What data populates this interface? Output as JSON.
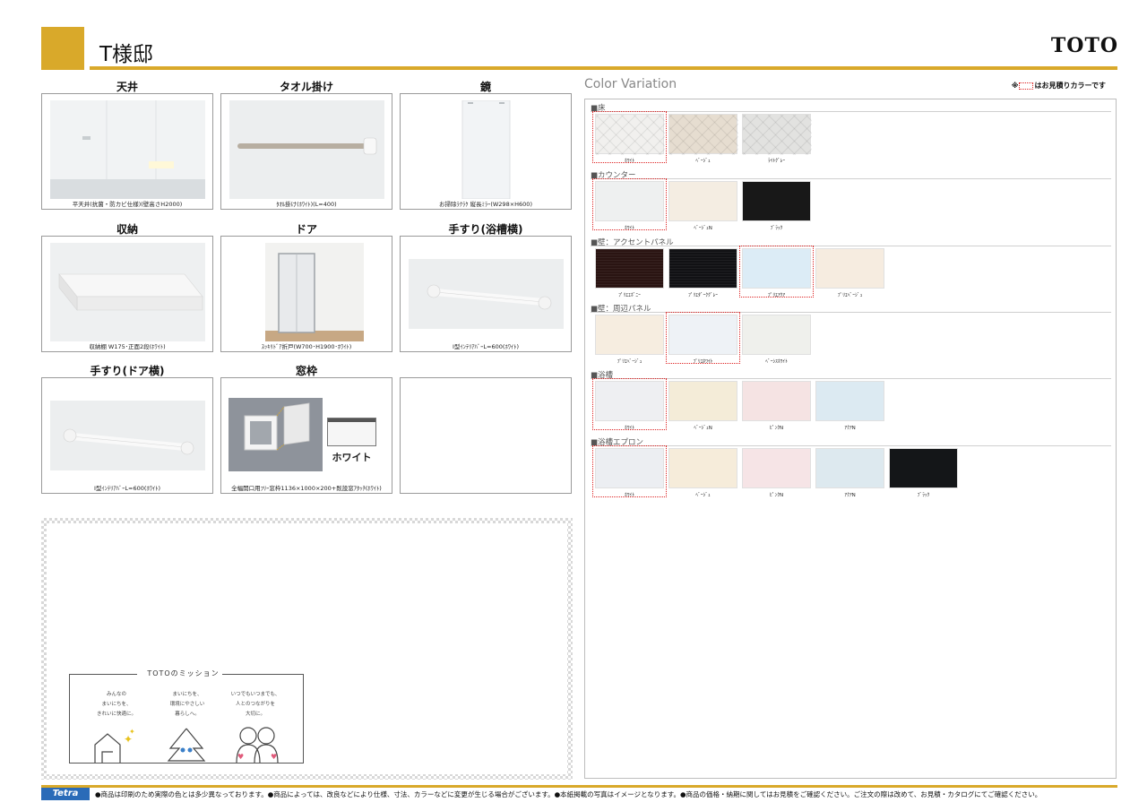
{
  "header": {
    "title": "T様邸",
    "brand": "TOTO"
  },
  "products": [
    {
      "title": "天井",
      "caption": "平天井(抗菌・防カビ仕様)(壁高さH2000)"
    },
    {
      "title": "タオル掛け",
      "caption": "ﾀｵﾙ掛け(ﾎﾜｲﾄ)(L=400)"
    },
    {
      "title": "鏡",
      "caption": "お掃除ﾗｸﾗｸ 縦長ﾐﾗｰ(W298×H600)"
    },
    {
      "title": "収納",
      "caption": "収納棚 W175･正面2段(ﾎﾜｲﾄ)"
    },
    {
      "title": "ドア",
      "caption": "ｽｯｷﾘﾄﾞｱ折戸(W700･H1900･ﾎﾜｲﾄ)"
    },
    {
      "title": "手すり(浴槽横)",
      "caption": "I型ｲﾝﾃﾘｱﾊﾞｰL=600(ﾎﾜｲﾄ)"
    },
    {
      "title": "手すり(ドア横)",
      "caption": "I型ｲﾝﾃﾘｱﾊﾞｰL=600(ﾎﾜｲﾄ)"
    },
    {
      "title": "窓枠",
      "caption": "全幅開口用ﾌﾘｰ窓枠1136×1000×200+既設窓ｱﾀｯﾁ(ﾎﾜｲﾄ)",
      "swatch_label": "ホワイト"
    },
    {
      "title": "",
      "caption": ""
    }
  ],
  "mission": {
    "title": "TOTOのミッション",
    "col1": [
      "みんなの",
      "まいにちを、",
      "きれいに快適に。"
    ],
    "col2": [
      "まいにちを、",
      "環境にやさしい",
      "暮らしへ。"
    ],
    "col3": [
      "いつでもいつまでも、",
      "人とのつながりを",
      "大切に。"
    ]
  },
  "color_variation": {
    "title": "Color Variation",
    "note_prefix": "※",
    "note_suffix": "はお見積りカラーです",
    "sections": [
      {
        "name": "■床",
        "swatches": [
          {
            "label": "ﾎﾜｲﾄ",
            "color": "#f1f0ee",
            "selected": true
          },
          {
            "label": "ﾍﾞｰｼﾞｭ",
            "color": "#e6ddd0"
          },
          {
            "label": "ﾗｲﾄｸﾞﾚｰ",
            "color": "#e2e2e0"
          }
        ]
      },
      {
        "name": "■カウンター",
        "swatches": [
          {
            "label": "ﾎﾜｲﾄ",
            "color": "#eef0f0",
            "selected": true
          },
          {
            "label": "ﾍﾞｰｼﾞｭN",
            "color": "#f4ede2"
          },
          {
            "label": "ﾌﾞﾗｯｸ",
            "color": "#181818"
          }
        ]
      },
      {
        "name": "■壁：アクセントパネル",
        "swatches": [
          {
            "label": "ﾌﾟﾘｴｴﾎﾞﾆｰ",
            "color": "#2a1412"
          },
          {
            "label": "ﾌﾟﾘｴﾀﾞｰｸｸﾞﾚｰ",
            "color": "#111114"
          },
          {
            "label": "ﾌﾟﾘｴｱｸｱ",
            "color": "#dcecf6",
            "selected": true
          },
          {
            "label": "ﾌﾟﾘｴﾍﾞｰｼﾞｭ",
            "color": "#f6ece0"
          }
        ]
      },
      {
        "name": "■壁：周辺パネル",
        "swatches": [
          {
            "label": "ﾌﾟﾘｴﾍﾞｰｼﾞｭ",
            "color": "#f6ede0"
          },
          {
            "label": "ﾌﾟﾘｴﾎﾜｲﾄ",
            "color": "#eef2f6",
            "selected": true
          },
          {
            "label": "ﾍﾞｰｼｽﾎﾜｲﾄ",
            "color": "#eff0ec"
          }
        ]
      },
      {
        "name": "■浴槽",
        "swatches": [
          {
            "label": "ﾎﾜｲﾄ",
            "color": "#eeeff2",
            "selected": true
          },
          {
            "label": "ﾍﾞｰｼﾞｭN",
            "color": "#f4ecd8"
          },
          {
            "label": "ﾋﾟﾝｸN",
            "color": "#f5e3e3"
          },
          {
            "label": "ｱｸｱN",
            "color": "#dceaf2"
          }
        ]
      },
      {
        "name": "■浴槽エプロン",
        "swatches": [
          {
            "label": "ﾎﾜｲﾄ",
            "color": "#eceef2",
            "selected": true
          },
          {
            "label": "ﾍﾞｰｼﾞｭ",
            "color": "#f6ecda"
          },
          {
            "label": "ﾋﾟﾝｸN",
            "color": "#f6e4e6"
          },
          {
            "label": "ｱｸｱN",
            "color": "#dde9ef"
          },
          {
            "label": "ﾌﾞﾗｯｸ",
            "color": "#141618"
          }
        ]
      }
    ]
  },
  "footer": {
    "logo": "Tetra",
    "text": "●商品は印刷のため実際の色とは多少異なっております。●商品によっては、改良などにより仕様、寸法、カラーなどに変更が生じる場合がございます。●本紙掲載の写真はイメージとなります。●商品の価格・納期に関してはお見積をご確認ください。ご注文の際は改めて、お見積・カタログにてご確認ください。"
  }
}
